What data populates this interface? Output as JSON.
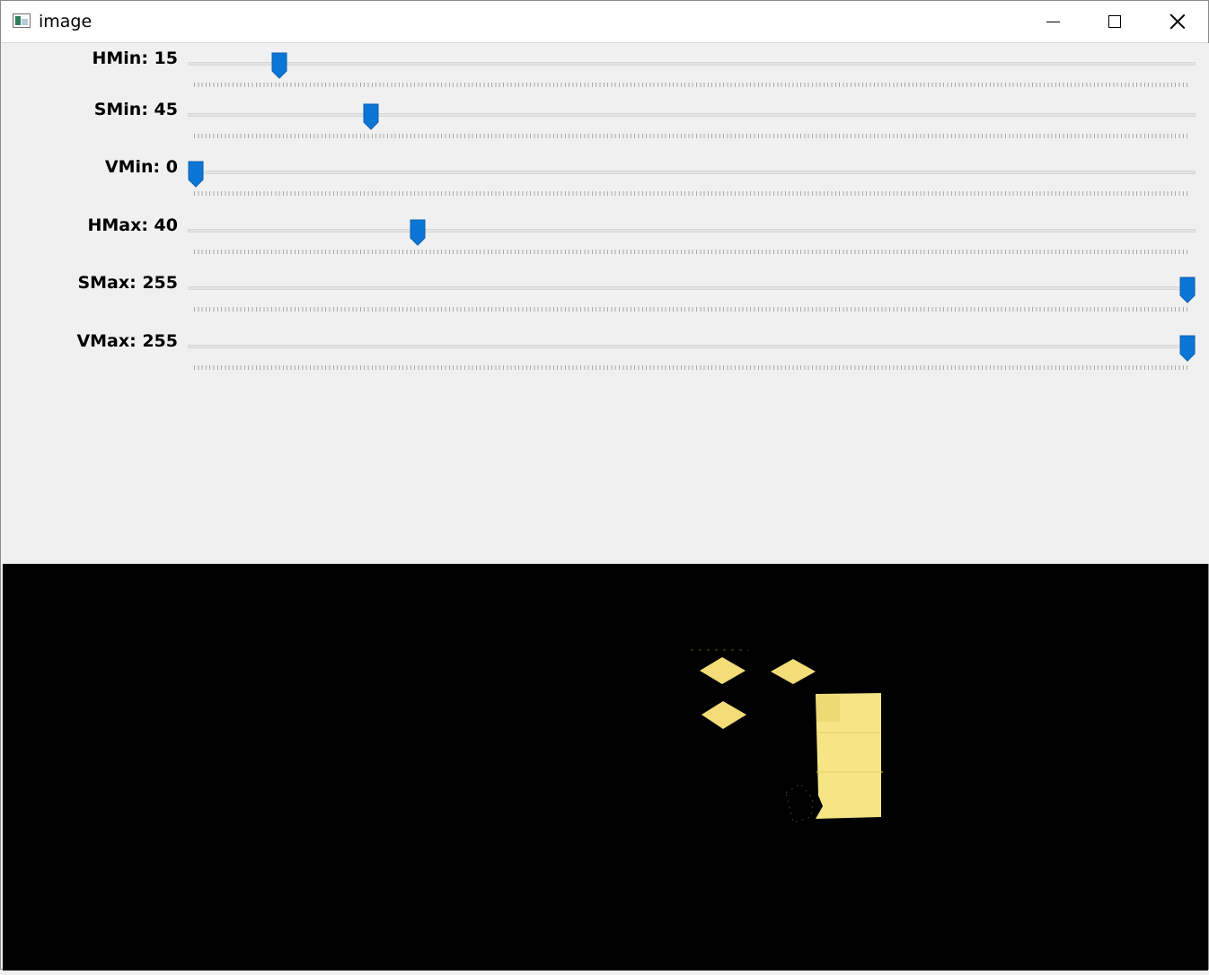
{
  "window": {
    "title": "image",
    "icon": "window-app-icon",
    "controls": {
      "minimize": "minimize-icon",
      "maximize": "maximize-icon",
      "close": "close-icon"
    }
  },
  "colors": {
    "thumb": "#0c76d6",
    "track": "#e4e4e4",
    "panel_bg": "#f0f0f0",
    "image_bg": "#000000",
    "mask_yellow": "#f5e27e"
  },
  "trackbars": [
    {
      "label": "HMin: 15",
      "value": 15,
      "max": 179
    },
    {
      "label": "SMin: 45",
      "value": 45,
      "max": 255
    },
    {
      "label": "VMin: 0",
      "value": 0,
      "max": 255
    },
    {
      "label": "HMax: 40",
      "value": 40,
      "max": 179
    },
    {
      "label": "SMax: 255",
      "value": 255,
      "max": 255
    },
    {
      "label": "VMax: 255",
      "value": 255,
      "max": 255
    }
  ]
}
